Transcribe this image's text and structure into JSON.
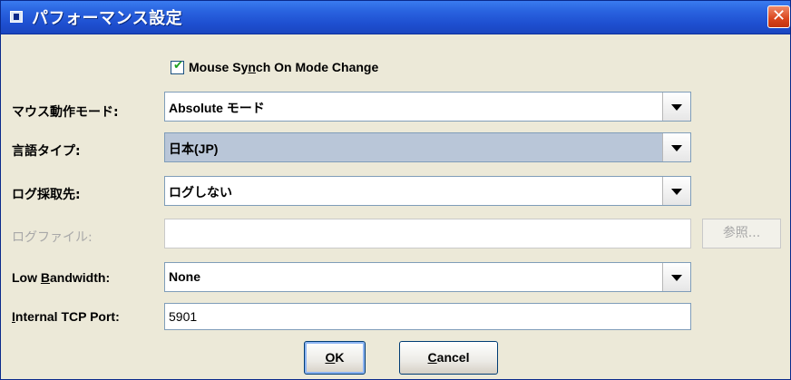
{
  "window": {
    "title": "パフォーマンス設定",
    "close_label": "✕"
  },
  "checkbox": {
    "label_pre": "Mouse Sy",
    "label_mnemonic": "n",
    "label_post": "ch On Mode Change",
    "checked": true,
    "mark": "✔"
  },
  "mouse_mode": {
    "label": "マウス動作モード:",
    "value": "Absolute モード"
  },
  "language": {
    "label": "言語タイプ:",
    "value": "日本(JP)"
  },
  "log_target": {
    "label": "ログ採取先:",
    "value": "ログしない"
  },
  "log_file": {
    "label": "ログファイル:",
    "value": "",
    "browse_label": "参照..."
  },
  "bandwidth": {
    "label_pre": "Low ",
    "label_mnemonic": "B",
    "label_post": "andwidth:",
    "value": "None"
  },
  "tcp_port": {
    "label_mnemonic": "I",
    "label_post": "nternal TCP Port:",
    "value": "5901"
  },
  "buttons": {
    "ok_mnemonic": "O",
    "ok_post": "K",
    "cancel_mnemonic": "C",
    "cancel_post": "ancel"
  },
  "colors": {
    "titlebar": "#2a64e0",
    "dialog_bg": "#ece9d8",
    "check_mark": "#21a121",
    "close_button": "#d9461d"
  }
}
